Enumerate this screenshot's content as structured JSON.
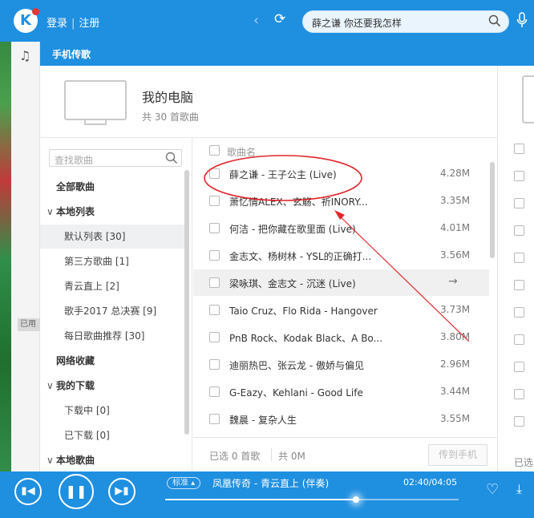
{
  "titlebar": {
    "logo_letter": "K",
    "login": "登录",
    "register": "注册",
    "search_text": "薛之谦 你还要我怎样"
  },
  "panel": {
    "header_label": "手机传歌",
    "device_name": "我的电脑",
    "device_count": "共 30 首歌曲"
  },
  "sidebar": {
    "search_placeholder": "查找歌曲",
    "used_badge": "已用",
    "items": [
      {
        "label": "全部歌曲",
        "kind": "hdr"
      },
      {
        "label": "本地列表",
        "kind": "hdr",
        "caret": "∨"
      },
      {
        "label": "默认列表 [30]",
        "kind": "sub",
        "selected": true
      },
      {
        "label": "第三方歌曲 [1]",
        "kind": "sub"
      },
      {
        "label": "青云直上 [2]",
        "kind": "sub"
      },
      {
        "label": "歌手2017 总决赛 [9]",
        "kind": "sub"
      },
      {
        "label": "每日歌曲推荐 [30]",
        "kind": "sub"
      },
      {
        "label": "网络收藏",
        "kind": "hdr"
      },
      {
        "label": "我的下载",
        "kind": "hdr",
        "caret": "∨"
      },
      {
        "label": "下载中 [0]",
        "kind": "sub"
      },
      {
        "label": "已下载 [0]",
        "kind": "sub"
      },
      {
        "label": "本地歌曲",
        "kind": "hdr",
        "caret": "∨"
      }
    ]
  },
  "songlist": {
    "column_name": "歌曲名",
    "songs": [
      {
        "title": "薛之谦 - 王子公主 (Live)",
        "size": "4.28M"
      },
      {
        "title": "萧忆情ALEX、玄觞、祈INORY...",
        "size": "3.35M"
      },
      {
        "title": "何洁 - 把你藏在歌里面 (Live)",
        "size": "4.01M"
      },
      {
        "title": "金志文、杨树林 - YSL的正确打...",
        "size": "3.56M"
      },
      {
        "title": "梁咏琪、金志文 - 沉迷 (Live)",
        "size": "",
        "hover": true
      },
      {
        "title": "Taio Cruz、Flo Rida - Hangover",
        "size": "3.73M"
      },
      {
        "title": "PnB Rock、Kodak Black、A Bo...",
        "size": "3.80M"
      },
      {
        "title": "迪丽热巴、张云龙 - 傲娇与偏见",
        "size": "2.96M"
      },
      {
        "title": "G-Eazy、Kehlani - Good Life",
        "size": "3.44M"
      },
      {
        "title": "魏晨 - 复杂人生",
        "size": "3.55M"
      }
    ],
    "selected_label": "已选 0 首歌",
    "total_label": "共  0M",
    "transfer_button": "传到手机",
    "right_partial_label": "已选"
  },
  "player": {
    "quality": "标准 ▴",
    "now_playing": "凤凰传奇 - 青云直上 (伴奏)",
    "time": "02:40/04:05",
    "progress": 0.65
  },
  "annotation_color": "#e0262b"
}
